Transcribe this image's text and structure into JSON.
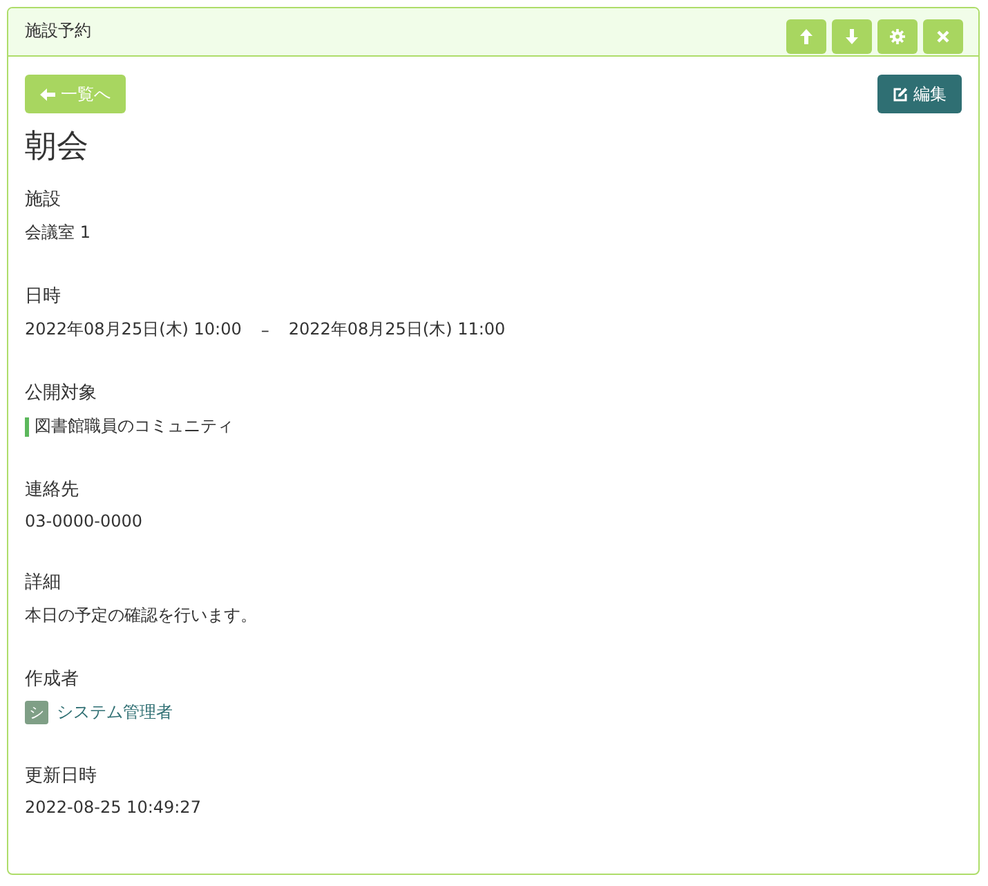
{
  "panel": {
    "title": "施設予約",
    "header_buttons": [
      {
        "kind": "up"
      },
      {
        "kind": "down"
      },
      {
        "kind": "settings"
      },
      {
        "kind": "close"
      }
    ]
  },
  "back_button": {
    "label": "一覧へ"
  },
  "edit_button": {
    "label": "編集"
  },
  "title": "朝会",
  "fields": [
    {
      "kind": "text",
      "label": "施設",
      "value": "会議室 1"
    },
    {
      "kind": "daterange",
      "label": "日時",
      "start": "2022年08月25日(木) 10:00",
      "separator": "–",
      "end": "2022年08月25日(木) 11:00"
    },
    {
      "kind": "community",
      "label": "公開対象",
      "value": "図書館職員のコミュニティ",
      "color": "#5cb85c"
    },
    {
      "kind": "text",
      "label": "連絡先",
      "value": "03-0000-0000"
    },
    {
      "kind": "text",
      "label": "詳細",
      "value": "本日の予定の確認を行います。"
    },
    {
      "kind": "user",
      "label": "作成者",
      "avatar": "シ",
      "value": "システム管理者"
    },
    {
      "kind": "text",
      "label": "更新日時",
      "value": "2022-08-25 10:49:27"
    }
  ]
}
